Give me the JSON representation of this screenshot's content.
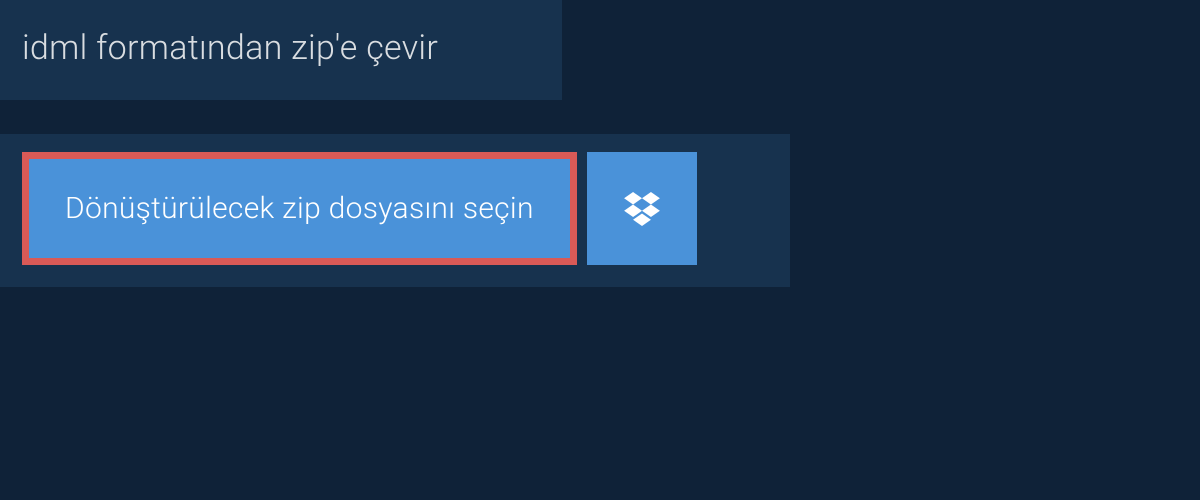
{
  "header": {
    "title": "idml formatından zip'e çevir"
  },
  "upload": {
    "select_file_label": "Dönüştürülecek zip dosyasını seçin",
    "dropbox_icon": "dropbox-icon"
  },
  "colors": {
    "page_bg": "#0f2238",
    "panel_bg": "#17324e",
    "button_bg": "#4a92d9",
    "button_border": "#d95a57",
    "text_light": "#d9dde1",
    "text_white": "#ffffff"
  }
}
